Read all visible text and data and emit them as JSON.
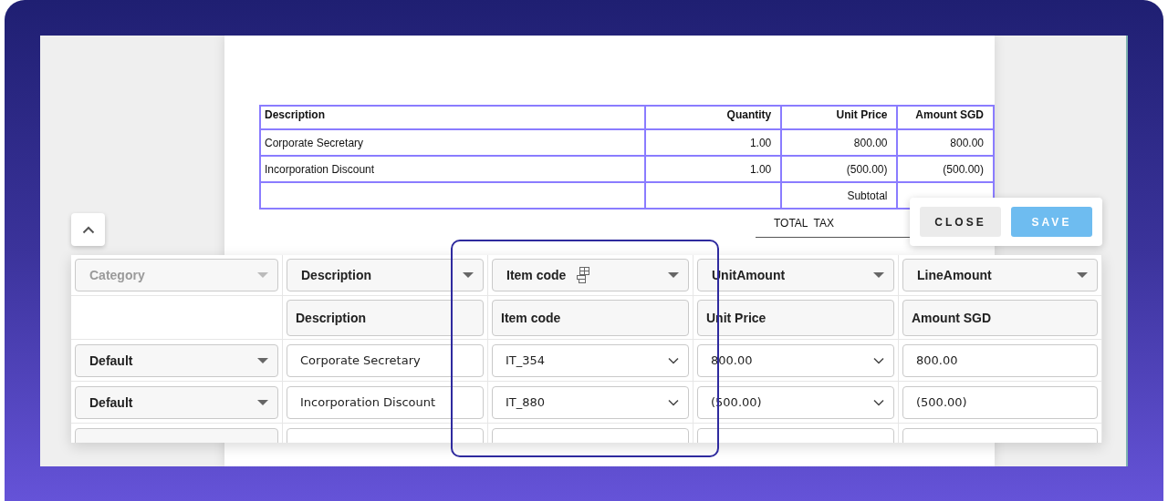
{
  "document": {
    "table": {
      "columns": [
        {
          "label": "Description"
        },
        {
          "label": "Quantity"
        },
        {
          "label": "Unit Price"
        },
        {
          "label": "Amount SGD"
        }
      ],
      "rows": [
        [
          "Corporate Secretary",
          "1.00",
          "800.00",
          "800.00"
        ],
        [
          "Incorporation Discount",
          "1.00",
          "(500.00)",
          "(500.00)"
        ],
        [
          null,
          null,
          "Subtotal",
          null
        ]
      ]
    },
    "totals": [
      {
        "label": "TOTAL  TAX"
      }
    ]
  },
  "mapping": {
    "columns": [
      {
        "field": "Category",
        "disabled": true,
        "has_icon": false
      },
      {
        "field": "Description",
        "disabled": false,
        "has_icon": false
      },
      {
        "field": "Item code",
        "disabled": false,
        "has_icon": true
      },
      {
        "field": "UnitAmount",
        "disabled": false,
        "has_icon": false
      },
      {
        "field": "LineAmount",
        "disabled": false,
        "has_icon": false
      }
    ],
    "labels": [
      {
        "kind": "blank"
      },
      {
        "kind": "label",
        "text": "Description"
      },
      {
        "kind": "label",
        "text": "Item code"
      },
      {
        "kind": "label",
        "text": "Unit Price"
      },
      {
        "kind": "label",
        "text": "Amount SGD"
      }
    ],
    "rows": [
      {
        "cells": [
          {
            "kind": "category",
            "value": "Default"
          },
          {
            "kind": "text",
            "value": "Corporate Secretary"
          },
          {
            "kind": "select",
            "value": "IT_354"
          },
          {
            "kind": "select",
            "value": "800.00"
          },
          {
            "kind": "text",
            "value": "800.00"
          }
        ]
      },
      {
        "cells": [
          {
            "kind": "category",
            "value": "Default"
          },
          {
            "kind": "text",
            "value": "Incorporation Discount"
          },
          {
            "kind": "select",
            "value": "IT_880"
          },
          {
            "kind": "select",
            "value": "(500.00)"
          },
          {
            "kind": "text",
            "value": "(500.00)"
          }
        ]
      }
    ]
  },
  "popup": {
    "buttons": [
      {
        "label": "CLOSE",
        "kind": "secondary"
      },
      {
        "label": "SAVE",
        "kind": "primary"
      }
    ]
  }
}
